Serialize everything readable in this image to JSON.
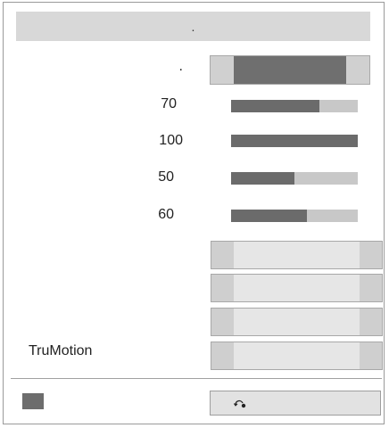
{
  "panel": {
    "title": "."
  },
  "rows": [
    {
      "label": "."
    },
    {
      "label": "70",
      "value": 70,
      "max": 100
    },
    {
      "label": "100",
      "value": 100,
      "max": 100
    },
    {
      "label": "50",
      "value": 50,
      "max": 100
    },
    {
      "label": "60",
      "value": 60,
      "max": 100
    },
    {
      "label": ""
    },
    {
      "label": ""
    },
    {
      "label": ""
    },
    {
      "label": "TruMotion"
    }
  ],
  "footer": {
    "reset_icon": "reset-icon"
  },
  "colors": {
    "fill": "#6b6b6b",
    "track": "#c8c8c8",
    "selected_segment": "#6f6f6f"
  }
}
